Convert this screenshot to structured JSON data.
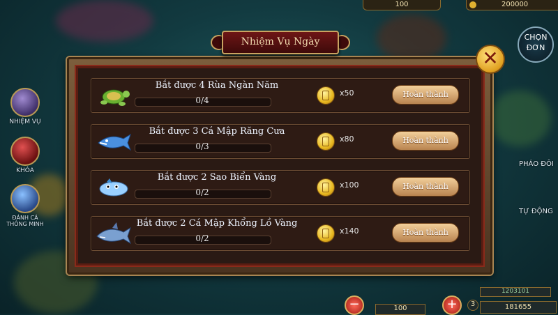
{
  "hud": {
    "top_bet": "100",
    "top_balance": "200000",
    "bottom_bet": "100",
    "bottom_small": "1203101",
    "bottom_balance": "181655",
    "bottom_level": "3"
  },
  "side_menu": [
    {
      "label": "NHIỆM VỤ"
    },
    {
      "label": "KHÓA"
    },
    {
      "label": "ĐÁNH CÁ THÔNG MINH"
    }
  ],
  "right_menu": {
    "chon_don": "CHỌN ĐƠN",
    "phao_doi": "PHÁO ĐÔI",
    "tu_dong": "TỰ ĐỘNG"
  },
  "dialog": {
    "title": "Nhiệm Vụ Ngày",
    "close_symbol": "✕"
  },
  "tasks": [
    {
      "name": "Bắt được 4 Rùa Ngàn Năm",
      "progress": "0/4",
      "fraction": 0,
      "reward": "x50",
      "button": "Hoàn thành",
      "fish_icon": "turtle-icon"
    },
    {
      "name": "Bắt được 3 Cá Mập Răng Cưa",
      "progress": "0/3",
      "fraction": 0,
      "reward": "x80",
      "button": "Hoàn thành",
      "fish_icon": "sawshark-icon"
    },
    {
      "name": "Bắt được 2 Sao Biển Vàng",
      "progress": "0/2",
      "fraction": 0,
      "reward": "x100",
      "button": "Hoàn thành",
      "fish_icon": "starfish-icon"
    },
    {
      "name": "Bắt được 2 Cá Mập Khổng Lồ Vàng",
      "progress": "0/2",
      "fraction": 0,
      "reward": "x140",
      "button": "Hoàn thành",
      "fish_icon": "giant-shark-icon"
    }
  ],
  "colors": {
    "dialog_frame": "#7c5e3c",
    "title_plate": "#6e1616",
    "button": "#d9a970",
    "coin": "#e8b820"
  }
}
